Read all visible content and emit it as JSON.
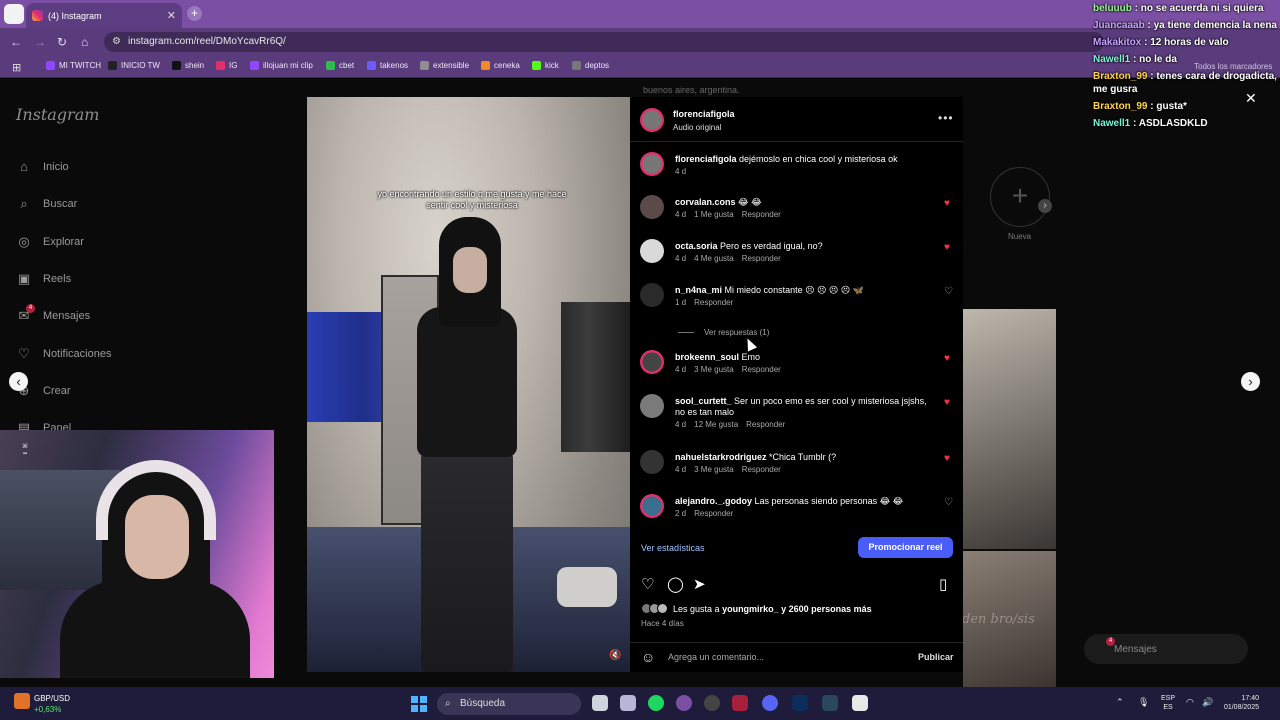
{
  "browser": {
    "tab_title": "(4) Instagram",
    "url": "instagram.com/reel/DMoYcavRr6Q/",
    "bookmarks": [
      {
        "label": "MI TWITCH",
        "color": "#9146ff"
      },
      {
        "label": "INICIO TW",
        "color": "#222222"
      },
      {
        "label": "shein",
        "color": "#111111"
      },
      {
        "label": "IG",
        "color": "#e1306c"
      },
      {
        "label": "illojuan mi clip",
        "color": "#9146ff"
      },
      {
        "label": "cbet",
        "color": "#2dbd4f"
      },
      {
        "label": "takenos",
        "color": "#6a5cff"
      },
      {
        "label": "extensible",
        "color": "#8e8e8e"
      },
      {
        "label": "ceneka",
        "color": "#f08a24"
      },
      {
        "label": "kick",
        "color": "#53fc18"
      },
      {
        "label": "deptos",
        "color": "#777777"
      }
    ],
    "all_bookmarks": "Todos los marcadores"
  },
  "instagram": {
    "logo": "Instagram",
    "nav": [
      {
        "label": "Inicio",
        "icon": "home-icon"
      },
      {
        "label": "Buscar",
        "icon": "search-icon"
      },
      {
        "label": "Explorar",
        "icon": "compass-icon"
      },
      {
        "label": "Reels",
        "icon": "reels-icon"
      },
      {
        "label": "Mensajes",
        "icon": "messenger-icon",
        "badge": "4"
      },
      {
        "label": "Notificaciones",
        "icon": "heart-icon"
      },
      {
        "label": "Crear",
        "icon": "plus-icon"
      },
      {
        "label": "Panel",
        "icon": "dashboard-icon"
      }
    ],
    "bg_location": "buenos aires, argentina.",
    "new_highlight": "Nueva",
    "bg_thumb_text": "den bro/sis",
    "messages_pill": "Mensajes",
    "messages_badge": "4"
  },
  "reel": {
    "caption": "yo encontrando un estilo q me gusta y me hace sentir cool y misteriosa",
    "author": "florenciafigola",
    "audio": "Audio original",
    "comments": [
      {
        "user": "florenciafigola",
        "text": "dejémoslo en chica cool y misteriosa ok",
        "time": "4 d",
        "likes": "",
        "reply": "",
        "liked": null
      },
      {
        "user": "corvalan.cons",
        "text": "😂 😂",
        "time": "4 d",
        "likes": "1 Me gusta",
        "reply": "Responder",
        "liked": true
      },
      {
        "user": "octa.soria",
        "text": "Pero es verdad igual, no?",
        "time": "4 d",
        "likes": "4 Me gusta",
        "reply": "Responder",
        "liked": true
      },
      {
        "user": "n_n4na_mi",
        "text": "Mi miedo constante 😣 😣 😣 😣 🦋",
        "time": "1 d",
        "likes": "",
        "reply": "Responder",
        "liked": false
      },
      {
        "user": "brokeenn_soul",
        "text": "Emo",
        "time": "4 d",
        "likes": "3 Me gusta",
        "reply": "Responder",
        "liked": true
      },
      {
        "user": "sool_curtett_",
        "text": "Ser un poco emo es ser cool y misteriosa jsjshs, no es tan malo",
        "time": "4 d",
        "likes": "12 Me gusta",
        "reply": "Responder",
        "liked": true
      },
      {
        "user": "nahuelstarkrodriguez",
        "text": "*Chica Tumblr (?",
        "time": "4 d",
        "likes": "3 Me gusta",
        "reply": "Responder",
        "liked": true
      },
      {
        "user": "alejandro._.godoy",
        "text": "Las personas siendo personas 😂 😂",
        "time": "2 d",
        "likes": "",
        "reply": "Responder",
        "liked": false
      }
    ],
    "view_replies": "Ver respuestas (1)",
    "stats_link": "Ver estadísticas",
    "promote_button": "Promocionar reel",
    "likes_prefix": "Les gusta a",
    "likes_user": "youngmirko_",
    "likes_suffix": "y 2600 personas más",
    "posted_ago": "Hace 4 días",
    "add_comment_placeholder": "Agrega un comentario...",
    "publish": "Publicar"
  },
  "chat": [
    {
      "user": "beluuub",
      "text": "no se acuerda ni si quiera",
      "color": "#9ff59a"
    },
    {
      "user": "Juancaaab",
      "text": "ya tiene demencia la nena",
      "color": "#c7a3ff"
    },
    {
      "user": "Makakitox",
      "text": "12 horas de valo",
      "color": "#c7a3ff"
    },
    {
      "user": "Nawell1",
      "text": "no le da",
      "color": "#7ff5d6"
    },
    {
      "user": "Braxton_99",
      "text": "tenes cara de drogadicta, me gusra",
      "color": "#ffd34d"
    },
    {
      "user": "Braxton_99",
      "text": "gusta*",
      "color": "#ffd34d"
    },
    {
      "user": "Nawell1",
      "text": "ASDLASDKLD",
      "color": "#7ff5d6"
    }
  ],
  "taskbar": {
    "ticker_name": "GBP/USD",
    "ticker_change": "+0,63%",
    "search": "Búsqueda",
    "lang1": "ESP",
    "lang2": "ES",
    "time": "17:40",
    "date": "01/08/2025"
  }
}
